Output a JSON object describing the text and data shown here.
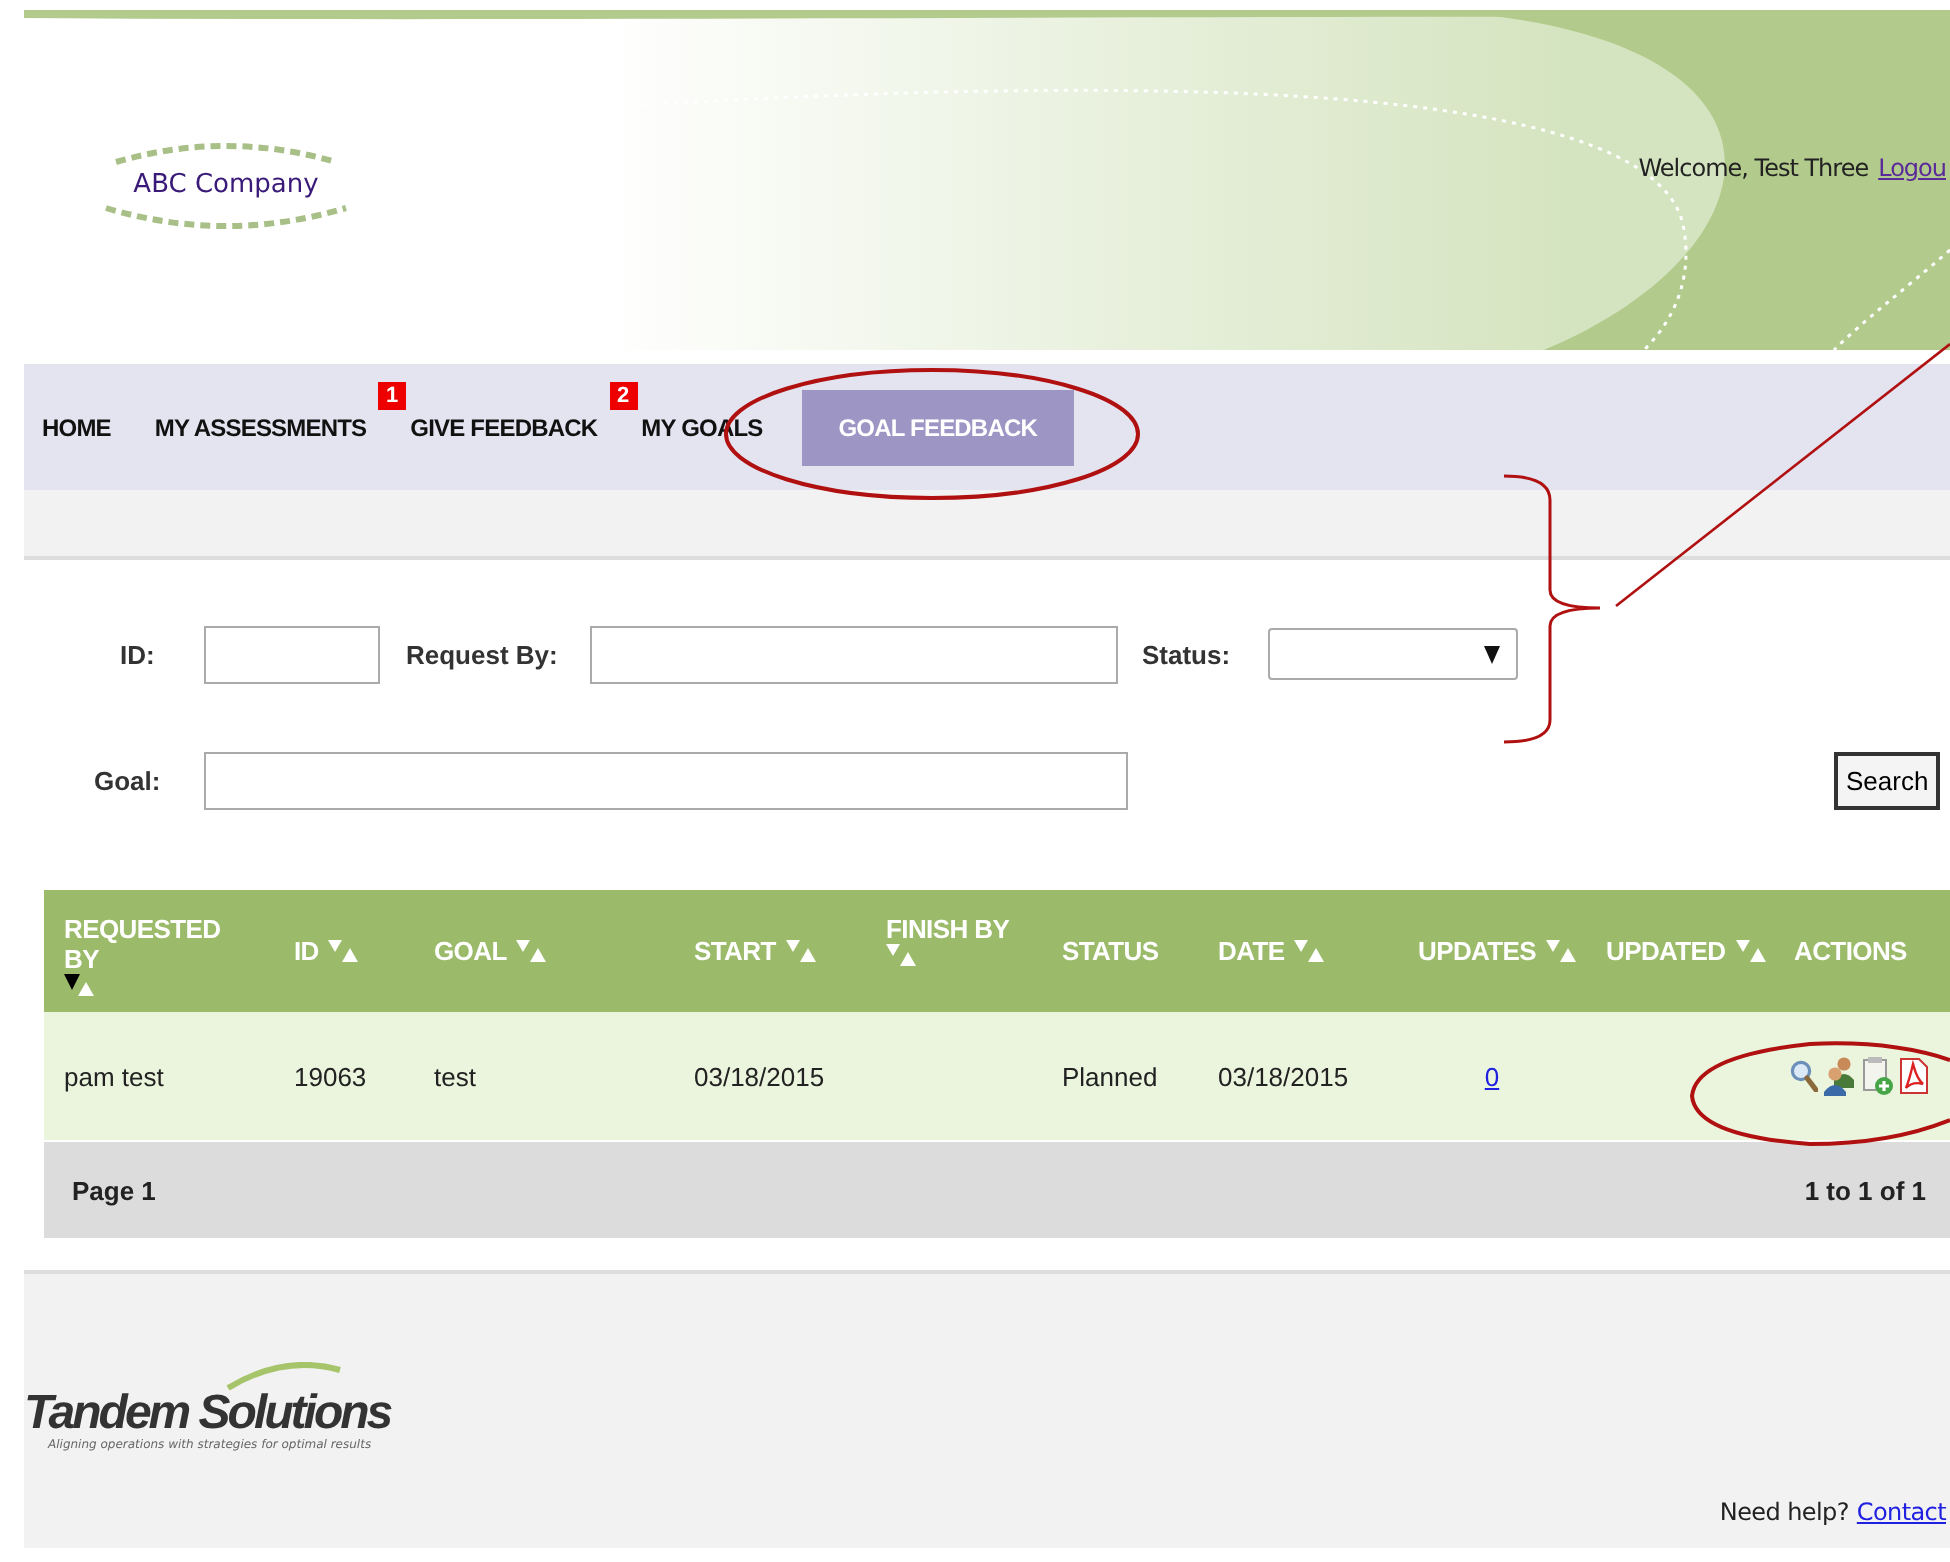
{
  "header": {
    "company": "ABC Company",
    "welcome": "Welcome, Test Three",
    "logout": "Logou"
  },
  "nav": [
    {
      "label": "HOME",
      "selected": false
    },
    {
      "label": "MY ASSESSMENTS",
      "badge": "1",
      "selected": false
    },
    {
      "label": "GIVE FEEDBACK",
      "badge": "2",
      "selected": false
    },
    {
      "label": "MY GOALS",
      "selected": false
    },
    {
      "label": "GOAL FEEDBACK",
      "selected": true
    }
  ],
  "search_form": {
    "id_label": "ID:",
    "request_by_label": "Request By:",
    "status_label": "Status:",
    "goal_label": "Goal:",
    "search_button": "Search"
  },
  "table": {
    "columns": [
      {
        "label": "REQUESTED BY",
        "sortable": true,
        "sorted": true
      },
      {
        "label": "ID",
        "sortable": true,
        "sorted": false
      },
      {
        "label": "GOAL",
        "sortable": true,
        "sorted": false
      },
      {
        "label": "START",
        "sortable": true,
        "sorted": false
      },
      {
        "label": "FINISH BY",
        "sortable": true,
        "sorted": false
      },
      {
        "label": "STATUS",
        "sortable": false
      },
      {
        "label": "DATE",
        "sortable": true,
        "sorted": false
      },
      {
        "label": "UPDATES",
        "sortable": true,
        "sorted": false
      },
      {
        "label": "UPDATED",
        "sortable": true,
        "sorted": false
      },
      {
        "label": "ACTIONS",
        "sortable": false
      }
    ],
    "rows": [
      {
        "requested_by": "pam test",
        "id": "19063",
        "goal": "test",
        "start": "03/18/2015",
        "finish_by": "",
        "status": "Planned",
        "date": "03/18/2015",
        "updates": "0",
        "updated": "",
        "actions": [
          {
            "kind": "view"
          },
          {
            "kind": "people"
          },
          {
            "kind": "add"
          },
          {
            "kind": "pdf"
          }
        ]
      }
    ],
    "page": "Page 1",
    "range": "1 to 1 of 1"
  },
  "footer": {
    "brand": "Tandem Solutions",
    "tagline": "Aligning operations with strategies for optimal results",
    "help": "Need help?",
    "contact": "Contact"
  }
}
